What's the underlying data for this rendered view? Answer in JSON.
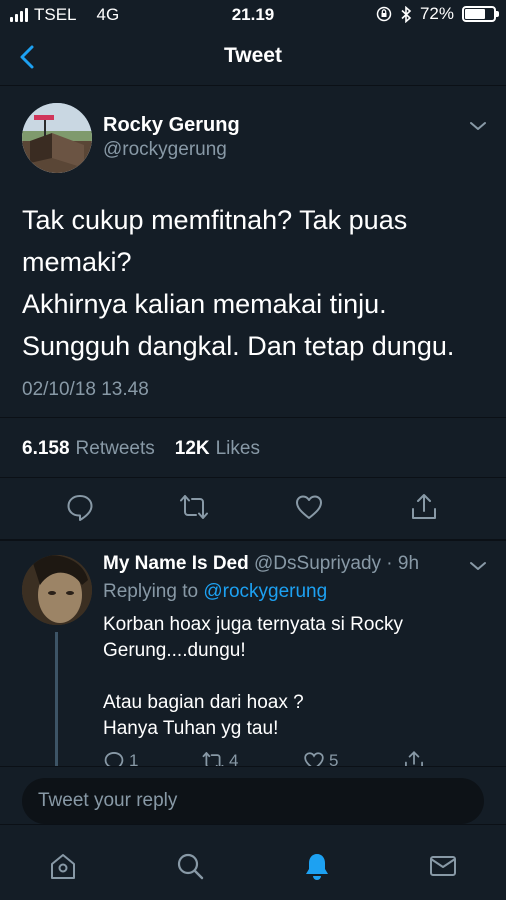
{
  "status_bar": {
    "carrier": "TSEL",
    "network": "4G",
    "time": "21.19",
    "battery": "72%",
    "battery_level": 0.72
  },
  "nav": {
    "title": "Tweet",
    "back_icon": "chevron-left-icon"
  },
  "tweet": {
    "author_name": "Rocky Gerung",
    "author_handle": "@rockygerung",
    "text_lines": [
      "Tak cukup memfitnah? Tak puas",
      "memaki?",
      "Akhirnya kalian memakai tinju.",
      "Sungguh dangkal. Dan tetap dungu."
    ],
    "date": "02/10/18 13.48",
    "retweets_count": "6.158",
    "retweets_label": "Retweets",
    "likes_count": "12K",
    "likes_label": "Likes",
    "actions": [
      "reply-icon",
      "retweet-icon",
      "like-icon",
      "share-icon"
    ]
  },
  "reply": {
    "name": "My Name Is Ded",
    "handle": "@DsSupriyady",
    "time": "· 9h",
    "replying_prefix": "Replying to",
    "replying_to": "@rockygerung",
    "text_lines": [
      "Korban hoax juga ternyata si Rocky",
      "Gerung....dungu!",
      "",
      "Atau bagian dari hoax ?",
      "Hanya Tuhan yg tau!"
    ],
    "reply_count": "1",
    "retweet_count": "4",
    "like_count": "5"
  },
  "reply_bar": {
    "placeholder": "Tweet your reply"
  },
  "tab_bar": {
    "items": [
      "home-icon",
      "search-icon",
      "notifications-icon",
      "messages-icon"
    ],
    "active": "notifications-icon"
  },
  "colors": {
    "background": "#141d26",
    "accent": "#1da1f2",
    "secondary_text": "#8899a6"
  }
}
